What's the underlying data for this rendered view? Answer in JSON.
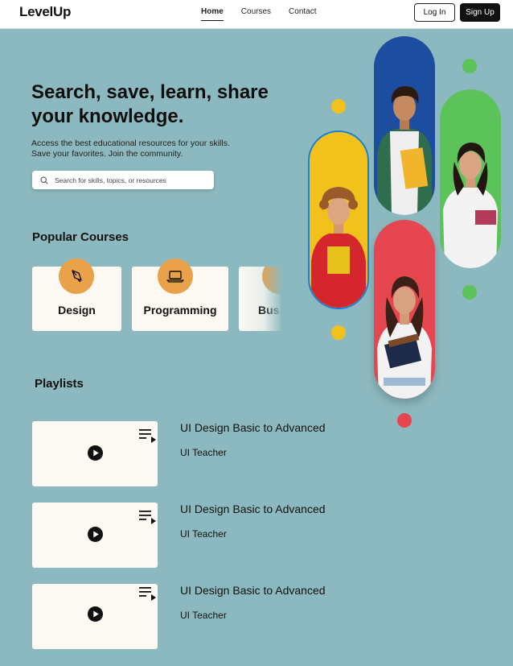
{
  "nav": {
    "logo": "LevelUp",
    "links": [
      "Home",
      "Courses",
      "Contact"
    ],
    "login": "Log In",
    "signup": "Sign Up"
  },
  "hero": {
    "title": "Search, save, learn, share your knowledge.",
    "subtitle": "Access the best educational resources for your skills. Save your favorites. Join the community.",
    "search_placeholder": "Search for skills, topics, or resources"
  },
  "popular": {
    "title": "Popular Courses",
    "courses": [
      {
        "label": "Design",
        "icon": "pen-tool-icon"
      },
      {
        "label": "Programming",
        "icon": "laptop-icon"
      },
      {
        "label": "Bus",
        "icon": "briefcase-icon"
      }
    ]
  },
  "playlists": {
    "title": "Playlists",
    "items": [
      {
        "title": "UI Design Basic to Advanced",
        "teacher": "UI Teacher"
      },
      {
        "title": "UI Design Basic to Advanced",
        "teacher": "UI Teacher"
      },
      {
        "title": "UI Design Basic to Advanced",
        "teacher": "UI Teacher"
      }
    ]
  },
  "colors": {
    "background": "#8cb9bf",
    "card": "#fcf9f2",
    "accent_orange": "#eaa24a",
    "pill_yellow": "#f1c21b",
    "pill_blue": "#1d4d9f",
    "pill_green": "#5cc35a",
    "pill_red": "#e6464f"
  }
}
